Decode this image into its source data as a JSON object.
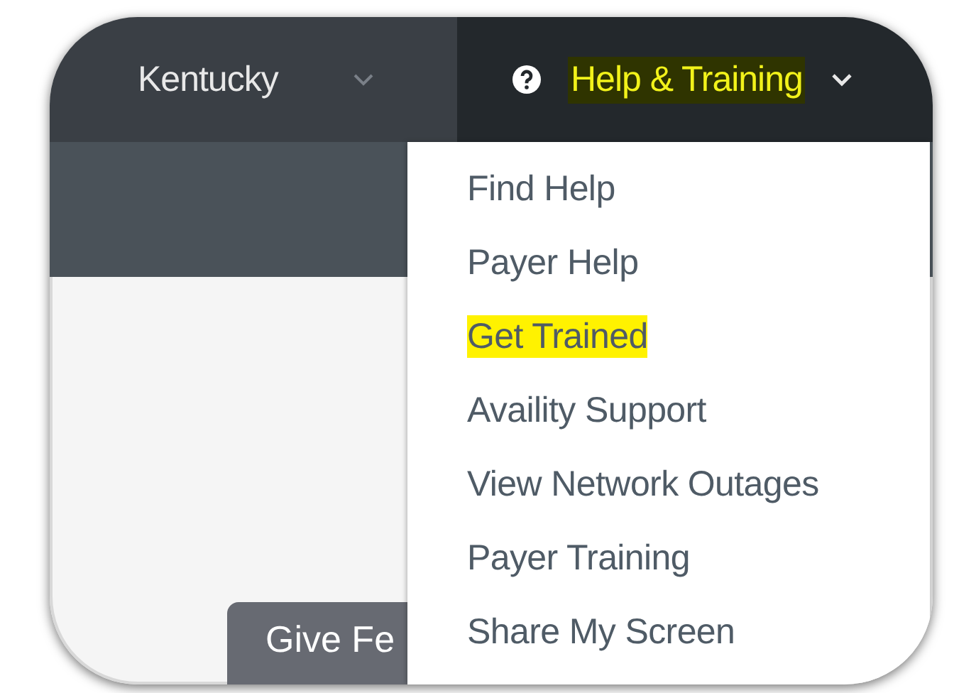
{
  "nav": {
    "state_menu": {
      "label": "Kentucky"
    },
    "help_menu": {
      "label": "Help & Training",
      "highlighted": true,
      "expanded": true
    }
  },
  "help_dropdown": {
    "items": [
      {
        "label": "Find Help",
        "highlighted": false
      },
      {
        "label": "Payer Help",
        "highlighted": false
      },
      {
        "label": "Get Trained",
        "highlighted": true
      },
      {
        "label": "Availity Support",
        "highlighted": false
      },
      {
        "label": "View Network Outages",
        "highlighted": false
      },
      {
        "label": "Payer Training",
        "highlighted": false
      },
      {
        "label": "Share My Screen",
        "highlighted": false
      }
    ]
  },
  "feedback_button": {
    "label": "Give Fe"
  }
}
